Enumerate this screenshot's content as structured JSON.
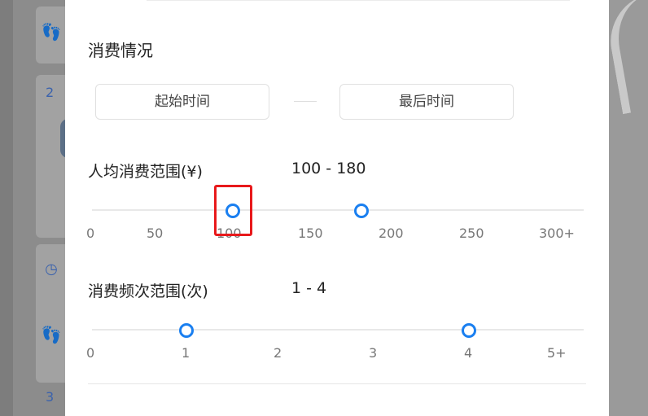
{
  "background": {
    "numbers": [
      "2",
      "3"
    ],
    "icons": [
      "footprint-icon",
      "clock-icon",
      "footprint-icon"
    ]
  },
  "filter": {
    "consumption_title": "消费情况",
    "start_time_label": "起始时间",
    "end_time_label": "最后时间",
    "avg_spend": {
      "label": "人均消费范围(¥)",
      "value_text": "100 - 180",
      "ticks": [
        "0",
        "50",
        "100",
        "150",
        "200",
        "250",
        "300+"
      ],
      "range": [
        100,
        180
      ],
      "max": 300
    },
    "frequency": {
      "label": "消费频次范围(次)",
      "value_text": "1 - 4",
      "ticks": [
        "0",
        "1",
        "2",
        "3",
        "4",
        "5+"
      ],
      "range": [
        1,
        4
      ],
      "max": 5
    }
  },
  "colors": {
    "accent": "#1a7ff0",
    "highlight": "#e8191b"
  }
}
